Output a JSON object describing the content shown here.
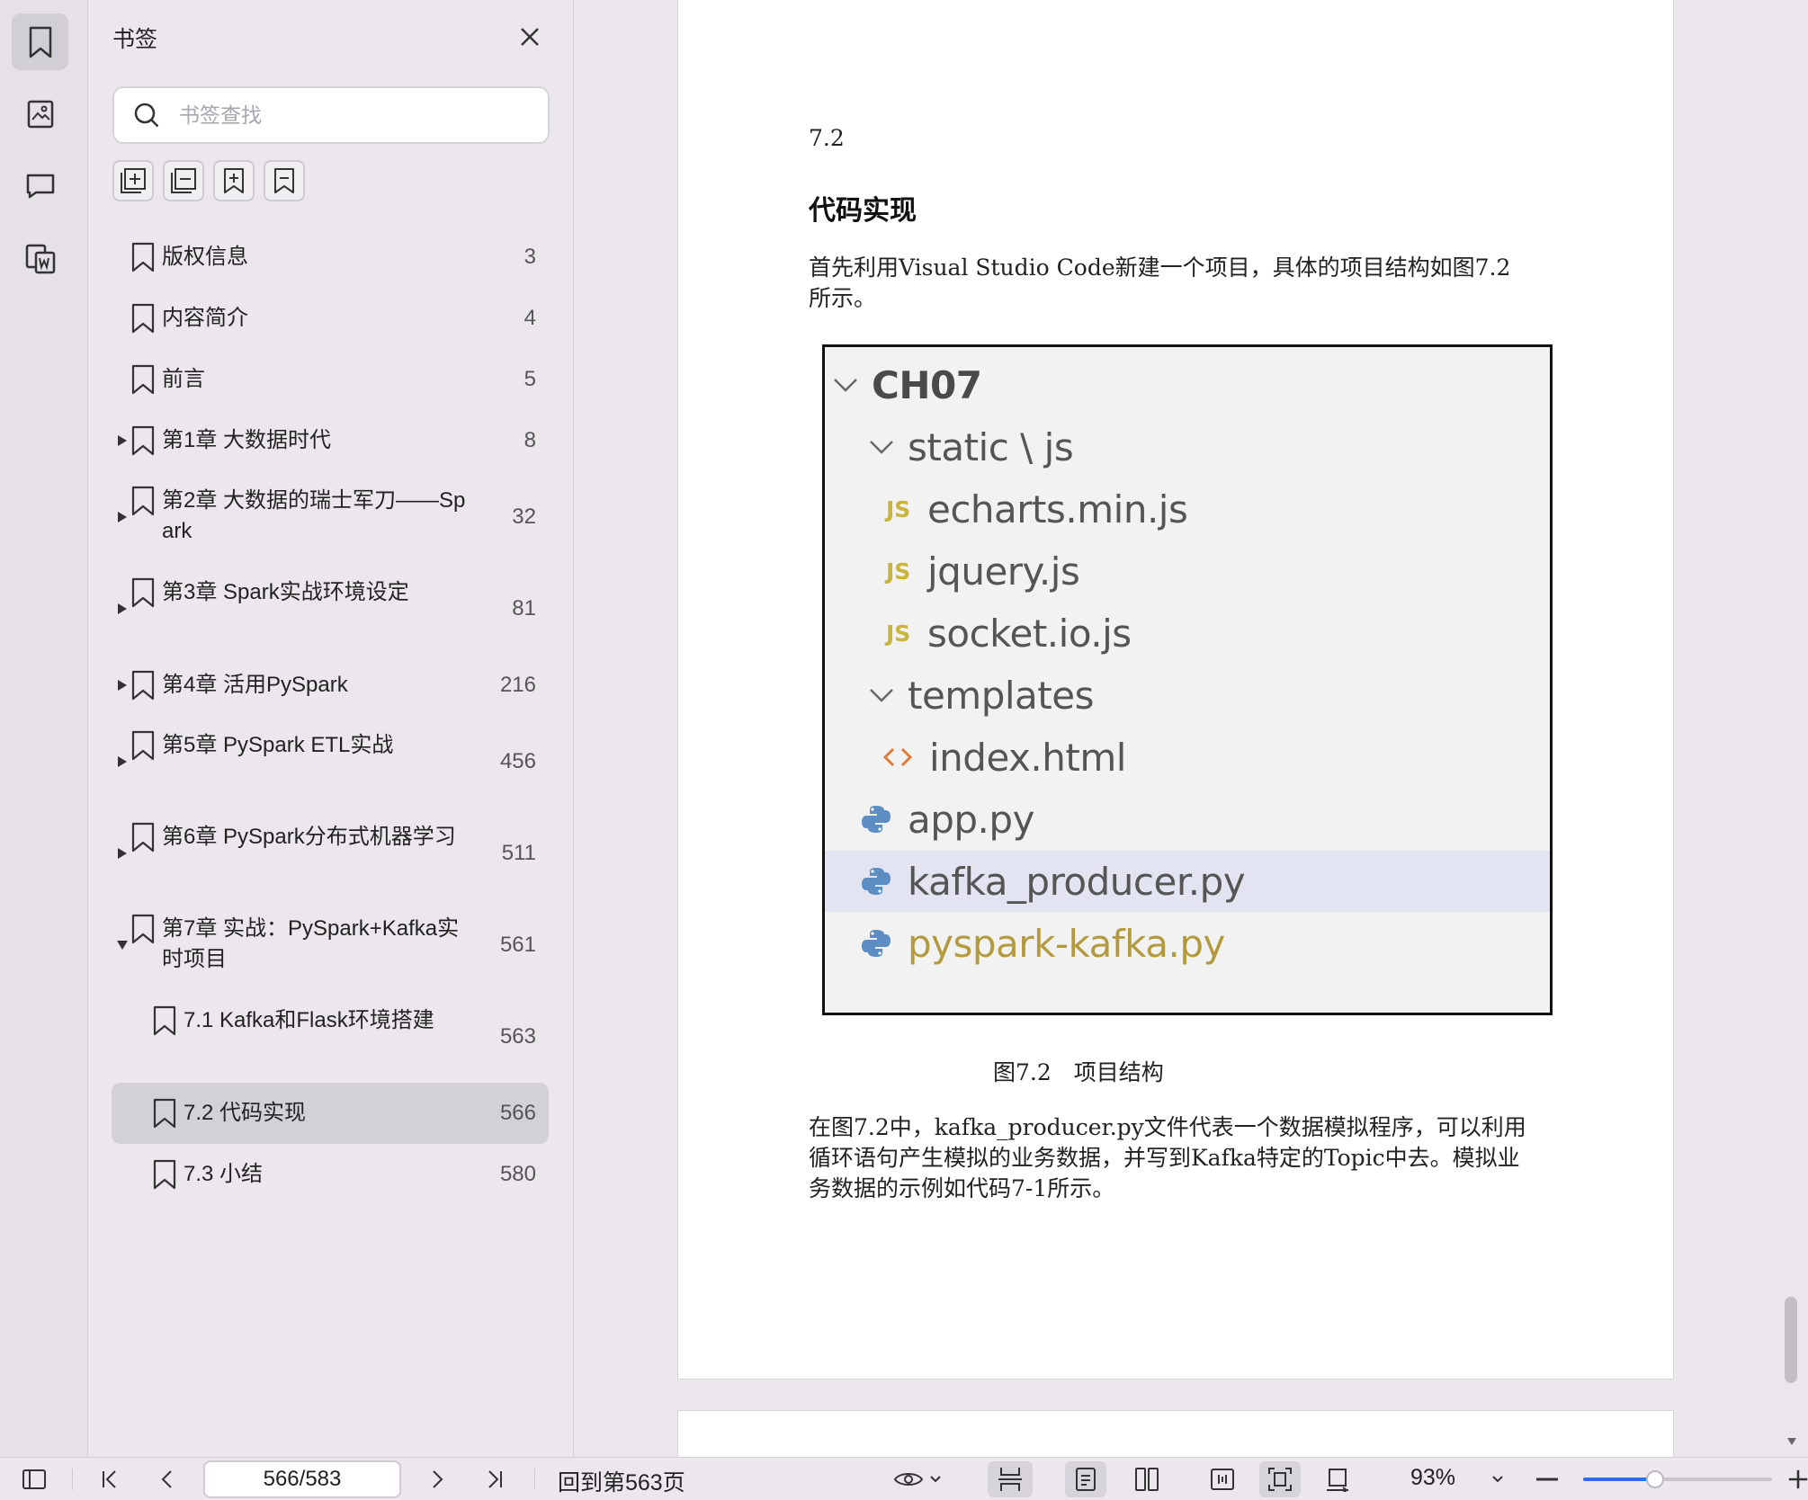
{
  "sidebar_panel": {
    "title": "书签",
    "search_placeholder": "书签查找",
    "tools": [
      "add-bookmark-icon",
      "remove-bookmark-icon",
      "expand-all-icon",
      "collapse-all-icon"
    ],
    "bookmarks": [
      {
        "label": "版权信息",
        "page": "3",
        "expandable": false,
        "expanded": false,
        "level": 0,
        "selected": false
      },
      {
        "label": "内容简介",
        "page": "4",
        "expandable": false,
        "expanded": false,
        "level": 0,
        "selected": false
      },
      {
        "label": "前言",
        "page": "5",
        "expandable": false,
        "expanded": false,
        "level": 0,
        "selected": false
      },
      {
        "label": "第1章 大数据时代",
        "page": "8",
        "expandable": true,
        "expanded": false,
        "level": 0,
        "selected": false
      },
      {
        "label": "第2章 大数据的瑞士军刀——Spark",
        "page": "32",
        "expandable": true,
        "expanded": false,
        "level": 0,
        "selected": false
      },
      {
        "label": "第3章 Spark实战环境设定",
        "page": "81",
        "expandable": true,
        "expanded": false,
        "level": 0,
        "selected": false
      },
      {
        "label": "第4章 活用PySpark",
        "page": "216",
        "expandable": true,
        "expanded": false,
        "level": 0,
        "selected": false
      },
      {
        "label": "第5章 PySpark ETL实战",
        "page": "456",
        "expandable": true,
        "expanded": false,
        "level": 0,
        "selected": false
      },
      {
        "label": "第6章 PySpark分布式机器学习",
        "page": "511",
        "expandable": true,
        "expanded": false,
        "level": 0,
        "selected": false
      },
      {
        "label": "第7章 实战：PySpark+Kafka实时项目",
        "page": "561",
        "expandable": true,
        "expanded": true,
        "level": 0,
        "selected": false
      },
      {
        "label": "7.1 Kafka和Flask环境搭建",
        "page": "563",
        "expandable": false,
        "expanded": false,
        "level": 1,
        "selected": false
      },
      {
        "label": "7.2 代码实现",
        "page": "566",
        "expandable": false,
        "expanded": false,
        "level": 1,
        "selected": true
      },
      {
        "label": "7.3 小结",
        "page": "580",
        "expandable": false,
        "expanded": false,
        "level": 1,
        "selected": false
      }
    ]
  },
  "rail": {
    "items": [
      "bookmark-icon",
      "thumbnail-icon",
      "comment-icon",
      "convert-icon"
    ]
  },
  "document": {
    "section_number": "7.2",
    "section_title": "代码实现",
    "paragraph1": "首先利用Visual  Studio  Code新建一个项目，具体的项目结构如图7.2所示。",
    "figure": {
      "rows": [
        {
          "kind": "folder",
          "name": "CH07",
          "indent": 0,
          "bold": true
        },
        {
          "kind": "folder",
          "name": "static \\ js",
          "indent": 1,
          "bold": false
        },
        {
          "kind": "js",
          "badge": "JS",
          "name": "echarts.min.js",
          "indent": 2
        },
        {
          "kind": "js",
          "badge": "JS",
          "name": "jquery.js",
          "indent": 2
        },
        {
          "kind": "js",
          "badge": "JS",
          "name": "socket.io.js",
          "indent": 2
        },
        {
          "kind": "folder",
          "name": "templates",
          "indent": 1,
          "bold": false
        },
        {
          "kind": "html",
          "name": "index.html",
          "indent": 2
        },
        {
          "kind": "py",
          "name": "app.py",
          "indent": 1,
          "highlight": false,
          "modified": false
        },
        {
          "kind": "py",
          "name": "kafka_producer.py",
          "indent": 1,
          "highlight": true,
          "modified": false
        },
        {
          "kind": "py",
          "name": "pyspark-kafka.py",
          "indent": 1,
          "highlight": false,
          "modified": true
        }
      ]
    },
    "caption": "图7.2　项目结构",
    "paragraph2": "在图7.2中，kafka_producer.py文件代表一个数据模拟程序，可以利用循环语句产生模拟的业务数据，并写到Kafka特定的Topic中去。模拟业务数据的示例如代码7-1所示。"
  },
  "bottom_bar": {
    "page_indicator": "566/583",
    "back_to": "回到第563页",
    "zoom": "93%",
    "zoom_level": 0.38
  }
}
